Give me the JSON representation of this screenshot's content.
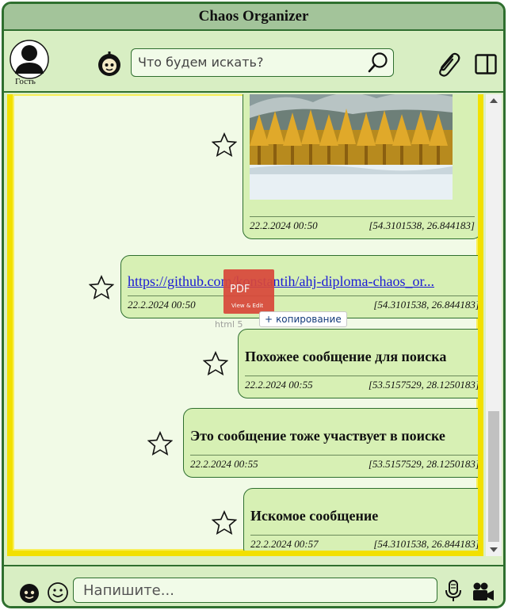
{
  "app": {
    "title": "Chaos Organizer"
  },
  "toolbar": {
    "user_label": "Гость",
    "search_placeholder": "Что будем искать?"
  },
  "messages": [
    {
      "type": "image",
      "date": "22.2.2024 00:50",
      "coords": "[54.3101538, 26.844183]"
    },
    {
      "type": "link",
      "text": "https://github.com/konstantih/ahj-diploma-chaos_or...",
      "date": "22.2.2024 00:50",
      "coords": "[54.3101538, 26.844183]"
    },
    {
      "type": "text",
      "text": "Похожее сообщение для поиска",
      "date": "22.2.2024 00:55",
      "coords": "[53.5157529, 28.1250183]"
    },
    {
      "type": "text",
      "text": "Это сообщение тоже участвует в поиске",
      "date": "22.2.2024 00:55",
      "coords": "[53.5157529, 28.1250183]"
    },
    {
      "type": "text",
      "text": "Искомое сообщение",
      "date": "22.2.2024 00:57",
      "coords": "[54.3101538, 26.844183]"
    }
  ],
  "drag_overlay": {
    "badge_text": "PDF",
    "badge_sub": "View & Edit",
    "tooltip": "копирование",
    "file_name": "html 5"
  },
  "footer": {
    "input_placeholder": "Напишите..."
  },
  "colors": {
    "frame": "#2f6f2f",
    "bubble": "#d7f0b4",
    "highlight": "#f2e000",
    "link": "#1a1ad6"
  }
}
